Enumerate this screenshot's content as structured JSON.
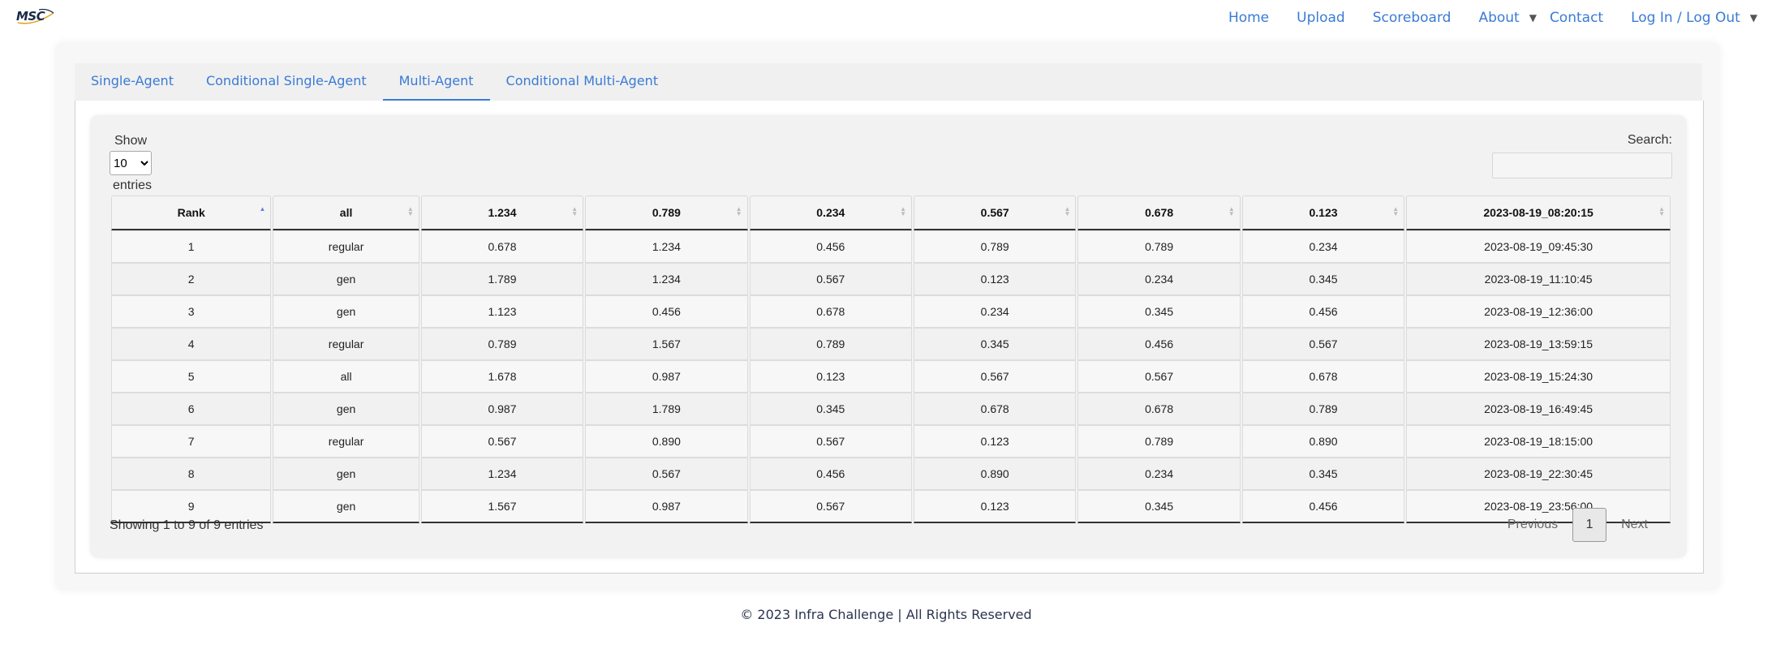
{
  "brand": {
    "logo_text": "MSC"
  },
  "nav": {
    "home": "Home",
    "upload": "Upload",
    "scoreboard": "Scoreboard",
    "about": "About",
    "contact": "Contact",
    "login": "Log In / Log Out",
    "dropdown_icon": "caret-down-icon"
  },
  "tabs": [
    {
      "label": "Single-Agent",
      "active": false
    },
    {
      "label": "Conditional Single-Agent",
      "active": false
    },
    {
      "label": "Multi-Agent",
      "active": true
    },
    {
      "label": "Conditional Multi-Agent",
      "active": false
    }
  ],
  "controls": {
    "show_label": "Show",
    "entries_value": "10",
    "entries_label": "entries",
    "search_label": "Search:"
  },
  "table": {
    "headers": [
      "Rank",
      "all",
      "1.234",
      "0.789",
      "0.234",
      "0.567",
      "0.678",
      "0.123",
      "2023-08-19_08:20:15"
    ],
    "sorted_column": "Rank",
    "rows": [
      [
        "1",
        "regular",
        "0.678",
        "1.234",
        "0.456",
        "0.789",
        "0.789",
        "0.234",
        "2023-08-19_09:45:30"
      ],
      [
        "2",
        "gen",
        "1.789",
        "1.234",
        "0.567",
        "0.123",
        "0.234",
        "0.345",
        "2023-08-19_11:10:45"
      ],
      [
        "3",
        "gen",
        "1.123",
        "0.456",
        "0.678",
        "0.234",
        "0.345",
        "0.456",
        "2023-08-19_12:36:00"
      ],
      [
        "4",
        "regular",
        "0.789",
        "1.567",
        "0.789",
        "0.345",
        "0.456",
        "0.567",
        "2023-08-19_13:59:15"
      ],
      [
        "5",
        "all",
        "1.678",
        "0.987",
        "0.123",
        "0.567",
        "0.567",
        "0.678",
        "2023-08-19_15:24:30"
      ],
      [
        "6",
        "gen",
        "0.987",
        "1.789",
        "0.345",
        "0.678",
        "0.678",
        "0.789",
        "2023-08-19_16:49:45"
      ],
      [
        "7",
        "regular",
        "0.567",
        "0.890",
        "0.567",
        "0.123",
        "0.789",
        "0.890",
        "2023-08-19_18:15:00"
      ],
      [
        "8",
        "gen",
        "1.234",
        "0.567",
        "0.456",
        "0.890",
        "0.234",
        "0.345",
        "2023-08-19_22:30:45"
      ],
      [
        "9",
        "gen",
        "1.567",
        "0.987",
        "0.567",
        "0.123",
        "0.345",
        "0.456",
        "2023-08-19_23:56:00"
      ]
    ]
  },
  "info": "Showing 1 to 9 of 9 entries",
  "pagination": {
    "previous": "Previous",
    "current": "1",
    "next": "Next"
  },
  "footer": "© 2023 Infra Challenge | All Rights Reserved",
  "colors": {
    "link": "#3a7bd5",
    "sort_active": "#6b7fd6",
    "footer_text": "#2a3350"
  }
}
